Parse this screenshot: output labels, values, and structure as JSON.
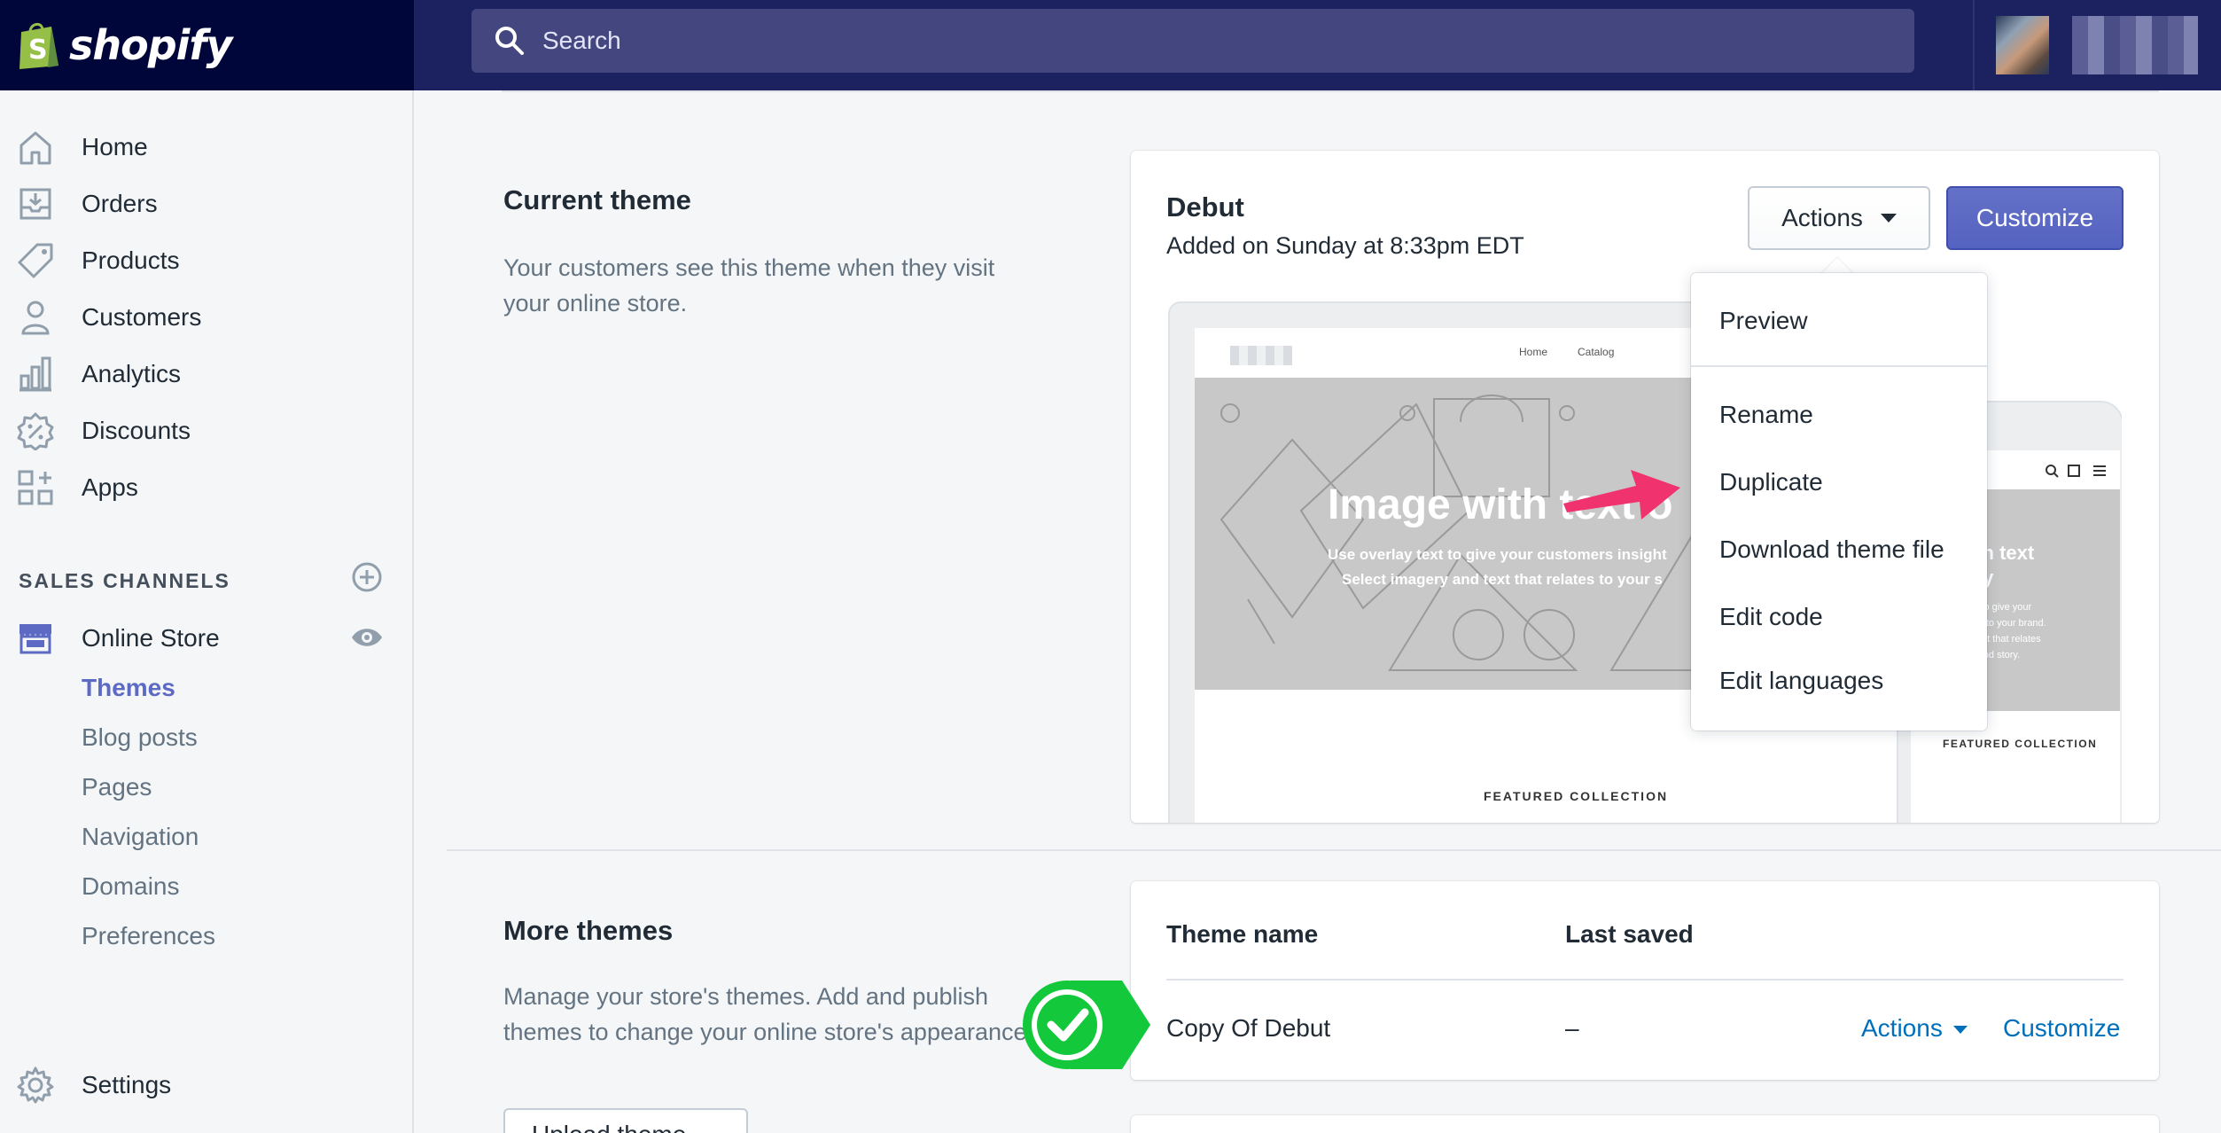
{
  "app": {
    "brand": "shopify"
  },
  "search": {
    "placeholder": "Search"
  },
  "sidebar": {
    "items": [
      {
        "label": "Home",
        "icon": "home-icon"
      },
      {
        "label": "Orders",
        "icon": "orders-icon"
      },
      {
        "label": "Products",
        "icon": "tag-icon"
      },
      {
        "label": "Customers",
        "icon": "person-icon"
      },
      {
        "label": "Analytics",
        "icon": "bar-chart-icon"
      },
      {
        "label": "Discounts",
        "icon": "discount-icon"
      },
      {
        "label": "Apps",
        "icon": "apps-icon"
      }
    ],
    "sales_channels_label": "SALES CHANNELS",
    "online_store": "Online Store",
    "subitems": [
      "Themes",
      "Blog posts",
      "Pages",
      "Navigation",
      "Domains",
      "Preferences"
    ],
    "active_subitem": "Themes",
    "settings": "Settings"
  },
  "current_theme": {
    "heading": "Current theme",
    "description": "Your customers see this theme when they visit your online store.",
    "name": "Debut",
    "added": "Added on Sunday at 8:33pm EDT",
    "actions_label": "Actions",
    "customize_label": "Customize",
    "preview": {
      "nav": [
        "Home",
        "Catalog"
      ],
      "hero_title": "Image with text o",
      "hero_sub_1": "Use overlay text to give your customers insight",
      "hero_sub_2": "Select imagery and text that relates to your s",
      "featured": "FEATURED COLLECTION",
      "phone_title_1": "with text",
      "phone_title_2": "erlay",
      "phone_sub": [
        "y text to give your",
        "sight into your brand.",
        "and text that relates",
        "style and story."
      ],
      "phone_featured": "FEATURED COLLECTION"
    }
  },
  "dropdown": {
    "items": [
      "Preview",
      "Rename",
      "Duplicate",
      "Download theme file",
      "Edit code",
      "Edit languages"
    ]
  },
  "more_themes": {
    "heading": "More themes",
    "description": "Manage your store's themes. Add and publish themes to change your online store's appearance.",
    "upload_label": "Upload theme",
    "columns": [
      "Theme name",
      "Last saved"
    ],
    "rows": [
      {
        "name": "Copy Of Debut",
        "last_saved": "–",
        "actions": "Actions",
        "customize": "Customize"
      }
    ]
  },
  "colors": {
    "topbar": "#1c2260",
    "logo_bg": "#000639",
    "accent": "#5c6ac4",
    "link": "#006fbb",
    "annotation_pink": "#f0326e",
    "annotation_green": "#14c83c"
  }
}
